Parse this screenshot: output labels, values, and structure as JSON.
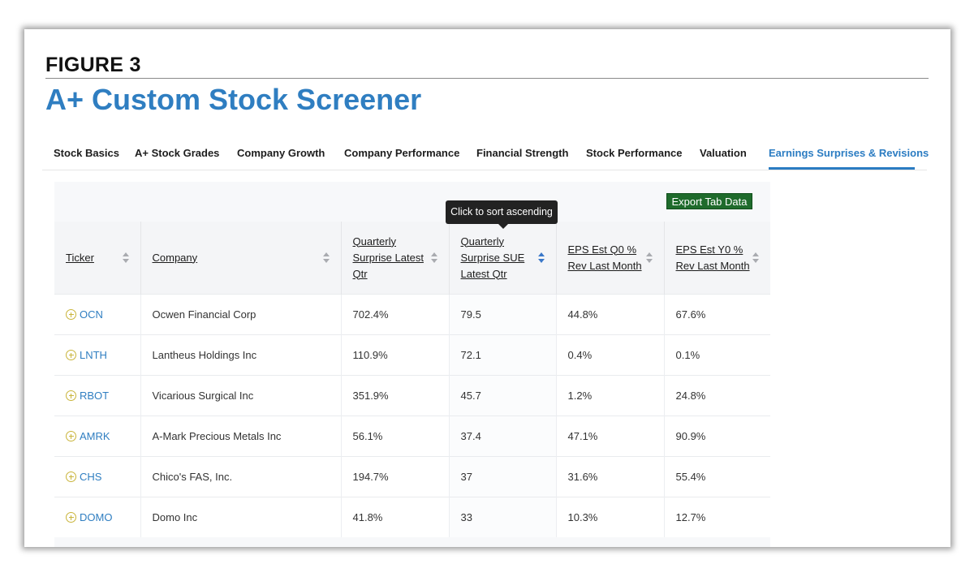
{
  "figure": {
    "label": "FIGURE 3",
    "title": "A+ Custom Stock Screener"
  },
  "tabs": [
    {
      "label": "Stock Basics",
      "active": false
    },
    {
      "label": "A+ Stock Grades",
      "active": false
    },
    {
      "label": "Company Growth",
      "active": false
    },
    {
      "label": "Company Performance",
      "active": false
    },
    {
      "label": "Financial Strength",
      "active": false
    },
    {
      "label": "Stock Performance",
      "active": false
    },
    {
      "label": "Valuation",
      "active": false
    },
    {
      "label": "Earnings Surprises & Revisions",
      "active": true
    }
  ],
  "export_button": "Export Tab Data",
  "tooltip": "Click to sort ascending",
  "columns": [
    {
      "label": "Ticker"
    },
    {
      "label": "Company"
    },
    {
      "label": "Quarterly Surprise Latest Qtr"
    },
    {
      "label": "Quarterly Surprise SUE Latest Qtr",
      "sorted": true
    },
    {
      "label": "EPS Est Q0 % Rev Last Month"
    },
    {
      "label": "EPS Est Y0 % Rev Last Month"
    }
  ],
  "rows": [
    [
      "OCN",
      "Ocwen Financial Corp",
      "702.4%",
      "79.5",
      "44.8%",
      "67.6%"
    ],
    [
      "LNTH",
      "Lantheus Holdings Inc",
      "110.9%",
      "72.1",
      "0.4%",
      "0.1%"
    ],
    [
      "RBOT",
      "Vicarious Surgical Inc",
      "351.9%",
      "45.7",
      "1.2%",
      "24.8%"
    ],
    [
      "AMRK",
      "A-Mark Precious Metals Inc",
      "56.1%",
      "37.4",
      "47.1%",
      "90.9%"
    ],
    [
      "CHS",
      "Chico's FAS, Inc.",
      "194.7%",
      "37",
      "31.6%",
      "55.4%"
    ],
    [
      "DOMO",
      "Domo Inc",
      "41.8%",
      "33",
      "10.3%",
      "12.7%"
    ]
  ],
  "icons": {
    "ticker_add": "plus-circle-icon",
    "sort": "sort-arrows-icon"
  },
  "colors": {
    "title_blue": "#2f7ec1",
    "active_tab": "#2b7cc2",
    "export_green": "#1f6b2c",
    "plus_gold": "#c9b43a"
  }
}
